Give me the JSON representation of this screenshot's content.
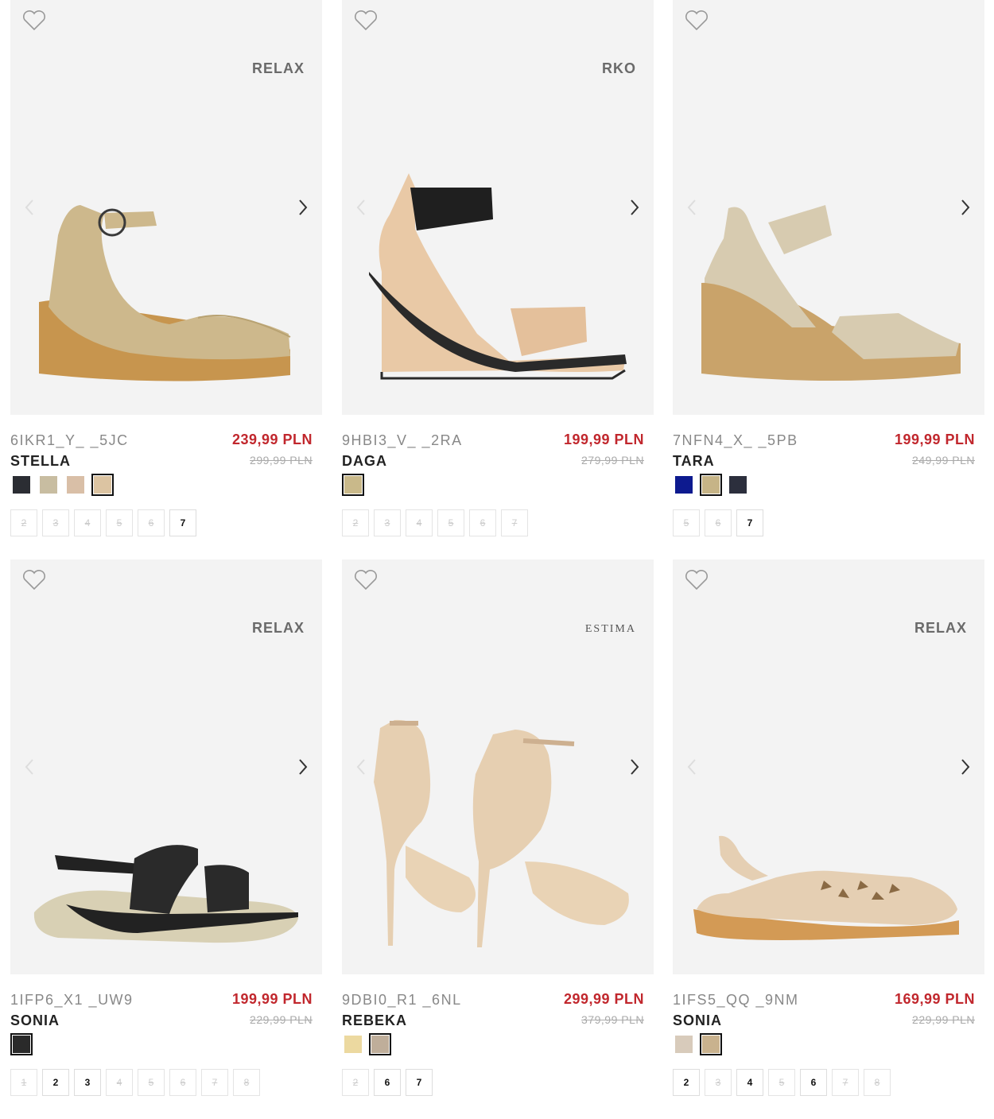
{
  "products": [
    {
      "brand": "RELAX",
      "sku": "6IKR1_Y_ _5JC",
      "name": "STELLA",
      "price": "239,99 PLN",
      "old_price": "299,99 PLN",
      "swatches": [
        {
          "color": "#2b2d33",
          "selected": false
        },
        {
          "color": "#c8bda1",
          "selected": false
        },
        {
          "color": "#d9bfa7",
          "selected": false
        },
        {
          "color": "#dcc4a2",
          "selected": true
        }
      ],
      "sizes": [
        {
          "label": "2",
          "available": false
        },
        {
          "label": "3",
          "available": false
        },
        {
          "label": "4",
          "available": false
        },
        {
          "label": "5",
          "available": false
        },
        {
          "label": "6",
          "available": false
        },
        {
          "label": "7",
          "available": true
        }
      ]
    },
    {
      "brand": "RKO",
      "sku": "9HBI3_V_ _2RA",
      "name": "DAGA",
      "price": "199,99 PLN",
      "old_price": "279,99 PLN",
      "swatches": [
        {
          "color": "#c9b98a",
          "selected": true
        }
      ],
      "sizes": [
        {
          "label": "2",
          "available": false
        },
        {
          "label": "3",
          "available": false
        },
        {
          "label": "4",
          "available": false
        },
        {
          "label": "5",
          "available": false
        },
        {
          "label": "6",
          "available": false
        },
        {
          "label": "7",
          "available": false
        }
      ]
    },
    {
      "brand": "",
      "sku": "7NFN4_X_ _5PB",
      "name": "TARA",
      "price": "199,99 PLN",
      "old_price": "249,99 PLN",
      "swatches": [
        {
          "color": "#0d1a8f",
          "selected": false
        },
        {
          "color": "#c6b487",
          "selected": true
        },
        {
          "color": "#2c2f3d",
          "selected": false
        }
      ],
      "sizes": [
        {
          "label": "5",
          "available": false
        },
        {
          "label": "6",
          "available": false
        },
        {
          "label": "7",
          "available": true
        }
      ]
    },
    {
      "brand": "RELAX",
      "sku": "1IFP6_X1 _UW9",
      "name": "SONIA",
      "price": "199,99 PLN",
      "old_price": "229,99 PLN",
      "swatches": [
        {
          "color": "#2a2a2a",
          "selected": true
        }
      ],
      "sizes": [
        {
          "label": "1",
          "available": false
        },
        {
          "label": "2",
          "available": true
        },
        {
          "label": "3",
          "available": true
        },
        {
          "label": "4",
          "available": false
        },
        {
          "label": "5",
          "available": false
        },
        {
          "label": "6",
          "available": false
        },
        {
          "label": "7",
          "available": false
        },
        {
          "label": "8",
          "available": false
        }
      ]
    },
    {
      "brand": "ESTIMA",
      "sku": "9DBI0_R1 _6NL",
      "name": "REBEKA",
      "price": "299,99 PLN",
      "old_price": "379,99 PLN",
      "swatches": [
        {
          "color": "#ecd9a0",
          "selected": false
        },
        {
          "color": "#bfae9a",
          "selected": true
        }
      ],
      "sizes": [
        {
          "label": "2",
          "available": false
        },
        {
          "label": "6",
          "available": true
        },
        {
          "label": "7",
          "available": true
        }
      ]
    },
    {
      "brand": "RELAX",
      "sku": "1IFS5_QQ _9NM",
      "name": "SONIA",
      "price": "169,99 PLN",
      "old_price": "229,99 PLN",
      "swatches": [
        {
          "color": "#d8cbbb",
          "selected": false
        },
        {
          "color": "#c9b28e",
          "selected": true
        }
      ],
      "sizes": [
        {
          "label": "2",
          "available": true
        },
        {
          "label": "3",
          "available": false
        },
        {
          "label": "4",
          "available": true
        },
        {
          "label": "5",
          "available": false
        },
        {
          "label": "6",
          "available": true
        },
        {
          "label": "7",
          "available": false
        },
        {
          "label": "8",
          "available": false
        }
      ]
    }
  ],
  "icons": {
    "wishlist": "heart-icon",
    "prev": "chevron-left-icon",
    "next": "chevron-right-icon"
  }
}
